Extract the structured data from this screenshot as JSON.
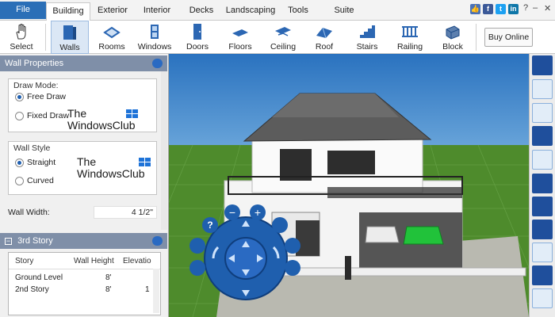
{
  "tabs": [
    {
      "label": "File"
    },
    {
      "label": "Building"
    },
    {
      "label": "Exterior"
    },
    {
      "label": "Interior"
    },
    {
      "label": "Decks"
    },
    {
      "label": "Landscaping"
    },
    {
      "label": "Tools"
    },
    {
      "label": "Suite"
    }
  ],
  "window_controls": {
    "help": "?",
    "minimize": "–",
    "close": "✕"
  },
  "ribbon": {
    "tools": [
      {
        "label": "Select",
        "icon": "hand-icon"
      },
      {
        "label": "Walls",
        "icon": "wall-icon"
      },
      {
        "label": "Rooms",
        "icon": "room-icon"
      },
      {
        "label": "Windows",
        "icon": "window-icon"
      },
      {
        "label": "Doors",
        "icon": "door-icon"
      },
      {
        "label": "Floors",
        "icon": "floor-icon"
      },
      {
        "label": "Ceiling",
        "icon": "ceiling-icon"
      },
      {
        "label": "Roof",
        "icon": "roof-icon"
      },
      {
        "label": "Stairs",
        "icon": "stairs-icon"
      },
      {
        "label": "Railing",
        "icon": "railing-icon"
      },
      {
        "label": "Block",
        "icon": "block-icon"
      }
    ],
    "buy_label": "Buy Online"
  },
  "wall_properties": {
    "title": "Wall Properties",
    "draw_mode": {
      "title": "Draw Mode:",
      "options": [
        "Free Draw",
        "Fixed Draw"
      ],
      "selected": "Free Draw"
    },
    "wall_style": {
      "title": "Wall Style",
      "options": [
        "Straight",
        "Curved"
      ],
      "selected": "Straight"
    },
    "wall_width_label": "Wall Width:",
    "wall_width_value": "4 1/2\""
  },
  "watermark": {
    "line1": "The",
    "line2": "WindowsClub"
  },
  "story_panel": {
    "title": "3rd Story",
    "columns": [
      "Story",
      "Wall Height",
      "Elevatio"
    ],
    "rows": [
      {
        "story": "Ground Level",
        "height": "8'",
        "elev": ""
      },
      {
        "story": "2nd Story",
        "height": "8'",
        "elev": "1"
      }
    ]
  },
  "colors": {
    "accent": "#2b6fb7",
    "panel_header": "#7f8fa8",
    "toolbar_dark": "#1f4f9c",
    "grass": "#4e8b2c",
    "sky": "#2f7fc6"
  }
}
